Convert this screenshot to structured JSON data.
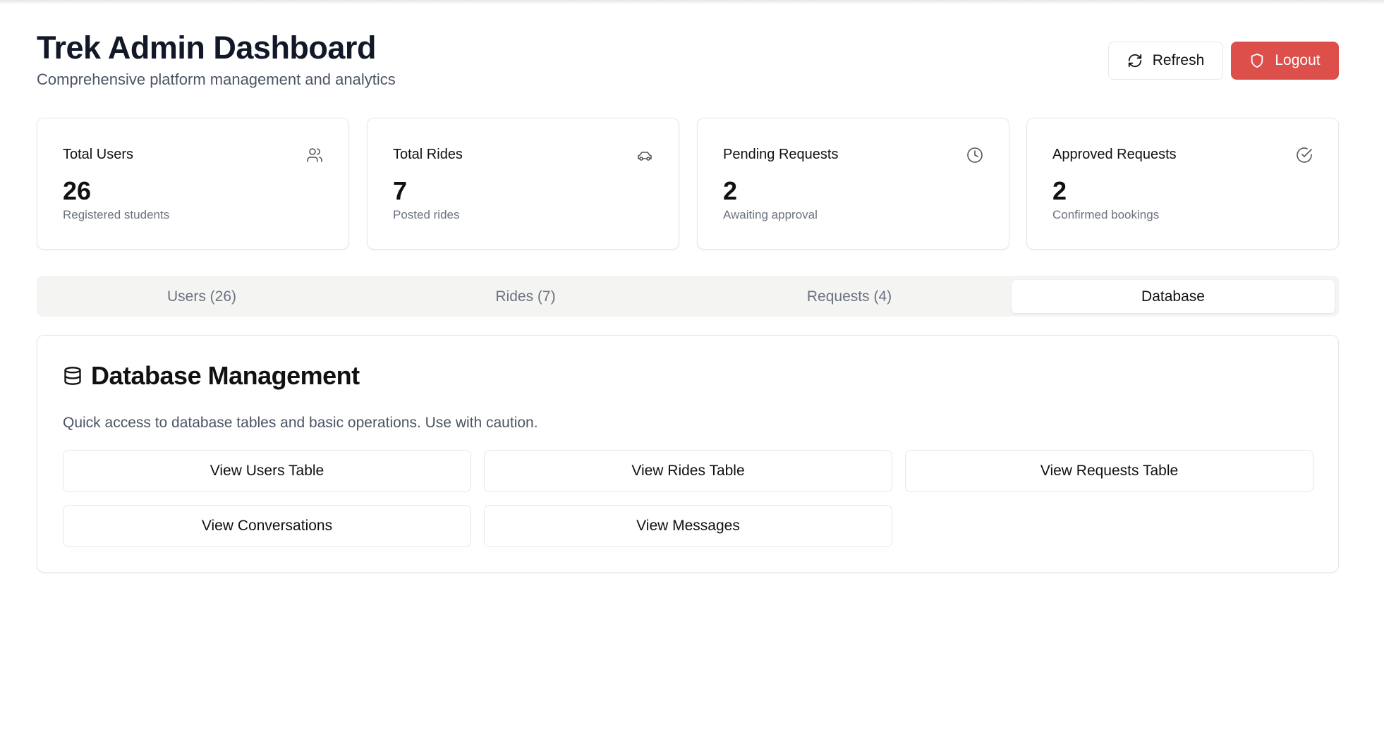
{
  "header": {
    "title": "Trek Admin Dashboard",
    "subtitle": "Comprehensive platform management and analytics",
    "refresh_label": "Refresh",
    "logout_label": "Logout"
  },
  "colors": {
    "logout": "#dc4f4b",
    "tab_bg": "#f4f4f3"
  },
  "stats": [
    {
      "title": "Total Users",
      "value": "26",
      "sub": "Registered students",
      "icon": "users-icon"
    },
    {
      "title": "Total Rides",
      "value": "7",
      "sub": "Posted rides",
      "icon": "car-icon"
    },
    {
      "title": "Pending Requests",
      "value": "2",
      "sub": "Awaiting approval",
      "icon": "clock-icon"
    },
    {
      "title": "Approved Requests",
      "value": "2",
      "sub": "Confirmed bookings",
      "icon": "check-circle-icon"
    }
  ],
  "tabs": [
    {
      "label": "Users (26)"
    },
    {
      "label": "Rides (7)"
    },
    {
      "label": "Requests (4)"
    },
    {
      "label": "Database",
      "active": true
    }
  ],
  "database": {
    "title": "Database Management",
    "description": "Quick access to database tables and basic operations. Use with caution.",
    "buttons": [
      {
        "label": "View Users Table"
      },
      {
        "label": "View Rides Table"
      },
      {
        "label": "View Requests Table"
      },
      {
        "label": "View Conversations"
      },
      {
        "label": "View Messages"
      }
    ]
  }
}
